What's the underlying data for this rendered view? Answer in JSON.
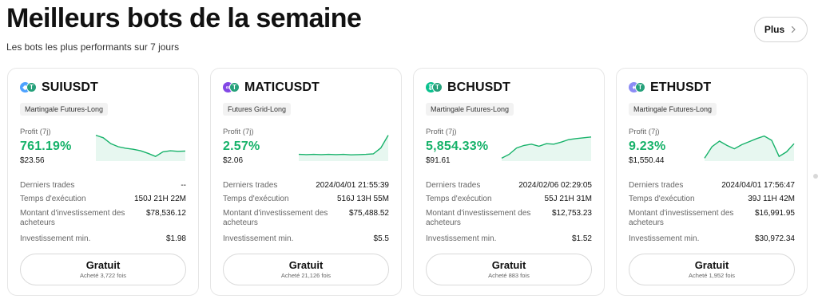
{
  "header": {
    "title": "Meilleurs bots de la semaine",
    "subtitle": "Les bots les plus performants sur 7 jours",
    "more_label": "Plus"
  },
  "labels": {
    "profit": "Profit (7j)",
    "last_trades": "Derniers trades",
    "exec_time": "Temps d'exécution",
    "invest_amount": "Montant d'investissement des acheteurs",
    "min_invest": "Investissement min.",
    "free_button": "Gratuit"
  },
  "colors": {
    "profit_green": "#17b26a",
    "tether": "#26a17b"
  },
  "cards": [
    {
      "symbol": "SUIUSDT",
      "coin_icon": "sui-coin-icon",
      "coin_color": "#4da2ff",
      "tag": "Martingale Futures-Long",
      "profit_pct": "761.19%",
      "profit_amount": "$23.56",
      "last_trade": "--",
      "exec_time": "150J 21H 22M",
      "invest_amount": "$78,536.12",
      "min_invest": "$1.98",
      "bought": "Acheté 3,722 fois",
      "trend": [
        0.95,
        0.85,
        0.62,
        0.5,
        0.44,
        0.4,
        0.34,
        0.24,
        0.12,
        0.3,
        0.34,
        0.32,
        0.33
      ]
    },
    {
      "symbol": "MATICUSDT",
      "coin_icon": "polygon-coin-icon",
      "coin_color": "#8247e5",
      "tag": "Futures Grid-Long",
      "profit_pct": "2.57%",
      "profit_amount": "$2.06",
      "last_trade": "2024/04/01 21:55:39",
      "exec_time": "516J 13H 55M",
      "invest_amount": "$75,488.52",
      "min_invest": "$5.5",
      "bought": "Acheté 21,126 fois",
      "trend": [
        0.2,
        0.19,
        0.2,
        0.19,
        0.2,
        0.19,
        0.2,
        0.18,
        0.19,
        0.2,
        0.22,
        0.45,
        0.95
      ]
    },
    {
      "symbol": "BCHUSDT",
      "coin_icon": "bitcoin-cash-coin-icon",
      "coin_color": "#0ac18e",
      "tag": "Martingale Futures-Long",
      "profit_pct": "5,854.33%",
      "profit_amount": "$91.61",
      "last_trade": "2024/02/06 02:29:05",
      "exec_time": "55J 21H 31M",
      "invest_amount": "$12,753.23",
      "min_invest": "$1.52",
      "bought": "Acheté 883 fois",
      "trend": [
        0.05,
        0.2,
        0.45,
        0.55,
        0.6,
        0.52,
        0.62,
        0.6,
        0.68,
        0.78,
        0.82,
        0.85,
        0.88
      ]
    },
    {
      "symbol": "ETHUSDT",
      "coin_icon": "ethereum-coin-icon",
      "coin_color": "#8c8cf5",
      "tag": "Martingale Futures-Long",
      "profit_pct": "9.23%",
      "profit_amount": "$1,550.44",
      "last_trade": "2024/04/01 17:56:47",
      "exec_time": "39J 11H 42M",
      "invest_amount": "$16,991.95",
      "min_invest": "$30,972.34",
      "bought": "Acheté 1,952 fois",
      "trend": [
        0.05,
        0.5,
        0.72,
        0.55,
        0.42,
        0.58,
        0.7,
        0.82,
        0.92,
        0.75,
        0.12,
        0.3,
        0.62
      ]
    }
  ]
}
